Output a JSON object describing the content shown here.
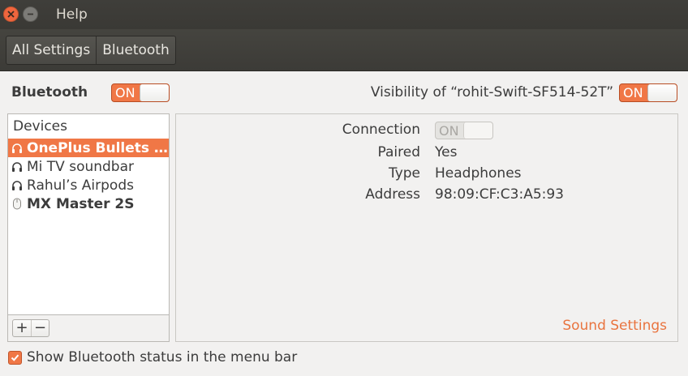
{
  "window": {
    "title": "Help",
    "close_icon": "close-icon",
    "minimize_icon": "minimize-icon"
  },
  "toolbar": {
    "breadcrumbs": [
      "All Settings",
      "Bluetooth"
    ]
  },
  "bluetooth": {
    "heading": "Bluetooth",
    "switch_label": "ON",
    "switch_on": true
  },
  "visibility": {
    "label": "Visibility of “rohit-Swift-SF514-52T”",
    "switch_label": "ON",
    "switch_on": true
  },
  "devices": {
    "header": "Devices",
    "items": [
      {
        "name": "OnePlus Bullets ...",
        "icon": "headphones-icon",
        "selected": true,
        "bold": true
      },
      {
        "name": "Mi TV soundbar",
        "icon": "headphones-icon",
        "selected": false,
        "bold": false
      },
      {
        "name": "Rahul’s Airpods",
        "icon": "headphones-icon",
        "selected": false,
        "bold": false
      },
      {
        "name": "MX Master 2S",
        "icon": "mouse-icon",
        "selected": false,
        "bold": true
      }
    ],
    "add_label": "+",
    "remove_label": "−"
  },
  "details": {
    "connection": {
      "key": "Connection",
      "switch_label": "ON",
      "enabled": false
    },
    "paired": {
      "key": "Paired",
      "value": "Yes"
    },
    "type": {
      "key": "Type",
      "value": "Headphones"
    },
    "address": {
      "key": "Address",
      "value": "98:09:CF:C3:A5:93"
    },
    "sound_settings_link": "Sound Settings"
  },
  "footer": {
    "show_status_label": "Show Bluetooth status in the menu bar",
    "show_status_checked": true
  },
  "colors": {
    "accent": "#f07746",
    "titlebar": "#3c3b37",
    "background": "#f2f1f0",
    "link": "#e9743f"
  }
}
